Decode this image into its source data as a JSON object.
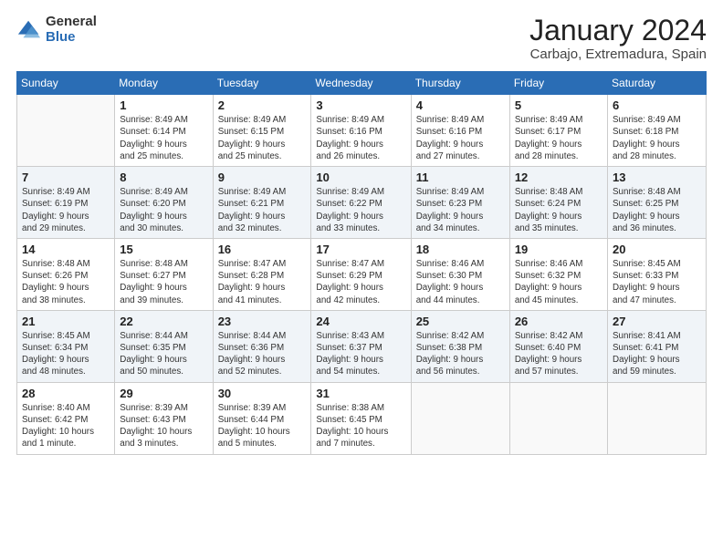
{
  "logo": {
    "general": "General",
    "blue": "Blue"
  },
  "title": "January 2024",
  "subtitle": "Carbajo, Extremadura, Spain",
  "days_header": [
    "Sunday",
    "Monday",
    "Tuesday",
    "Wednesday",
    "Thursday",
    "Friday",
    "Saturday"
  ],
  "weeks": [
    [
      {
        "num": "",
        "info": ""
      },
      {
        "num": "1",
        "info": "Sunrise: 8:49 AM\nSunset: 6:14 PM\nDaylight: 9 hours\nand 25 minutes."
      },
      {
        "num": "2",
        "info": "Sunrise: 8:49 AM\nSunset: 6:15 PM\nDaylight: 9 hours\nand 25 minutes."
      },
      {
        "num": "3",
        "info": "Sunrise: 8:49 AM\nSunset: 6:16 PM\nDaylight: 9 hours\nand 26 minutes."
      },
      {
        "num": "4",
        "info": "Sunrise: 8:49 AM\nSunset: 6:16 PM\nDaylight: 9 hours\nand 27 minutes."
      },
      {
        "num": "5",
        "info": "Sunrise: 8:49 AM\nSunset: 6:17 PM\nDaylight: 9 hours\nand 28 minutes."
      },
      {
        "num": "6",
        "info": "Sunrise: 8:49 AM\nSunset: 6:18 PM\nDaylight: 9 hours\nand 28 minutes."
      }
    ],
    [
      {
        "num": "7",
        "info": "Sunrise: 8:49 AM\nSunset: 6:19 PM\nDaylight: 9 hours\nand 29 minutes."
      },
      {
        "num": "8",
        "info": "Sunrise: 8:49 AM\nSunset: 6:20 PM\nDaylight: 9 hours\nand 30 minutes."
      },
      {
        "num": "9",
        "info": "Sunrise: 8:49 AM\nSunset: 6:21 PM\nDaylight: 9 hours\nand 32 minutes."
      },
      {
        "num": "10",
        "info": "Sunrise: 8:49 AM\nSunset: 6:22 PM\nDaylight: 9 hours\nand 33 minutes."
      },
      {
        "num": "11",
        "info": "Sunrise: 8:49 AM\nSunset: 6:23 PM\nDaylight: 9 hours\nand 34 minutes."
      },
      {
        "num": "12",
        "info": "Sunrise: 8:48 AM\nSunset: 6:24 PM\nDaylight: 9 hours\nand 35 minutes."
      },
      {
        "num": "13",
        "info": "Sunrise: 8:48 AM\nSunset: 6:25 PM\nDaylight: 9 hours\nand 36 minutes."
      }
    ],
    [
      {
        "num": "14",
        "info": "Sunrise: 8:48 AM\nSunset: 6:26 PM\nDaylight: 9 hours\nand 38 minutes."
      },
      {
        "num": "15",
        "info": "Sunrise: 8:48 AM\nSunset: 6:27 PM\nDaylight: 9 hours\nand 39 minutes."
      },
      {
        "num": "16",
        "info": "Sunrise: 8:47 AM\nSunset: 6:28 PM\nDaylight: 9 hours\nand 41 minutes."
      },
      {
        "num": "17",
        "info": "Sunrise: 8:47 AM\nSunset: 6:29 PM\nDaylight: 9 hours\nand 42 minutes."
      },
      {
        "num": "18",
        "info": "Sunrise: 8:46 AM\nSunset: 6:30 PM\nDaylight: 9 hours\nand 44 minutes."
      },
      {
        "num": "19",
        "info": "Sunrise: 8:46 AM\nSunset: 6:32 PM\nDaylight: 9 hours\nand 45 minutes."
      },
      {
        "num": "20",
        "info": "Sunrise: 8:45 AM\nSunset: 6:33 PM\nDaylight: 9 hours\nand 47 minutes."
      }
    ],
    [
      {
        "num": "21",
        "info": "Sunrise: 8:45 AM\nSunset: 6:34 PM\nDaylight: 9 hours\nand 48 minutes."
      },
      {
        "num": "22",
        "info": "Sunrise: 8:44 AM\nSunset: 6:35 PM\nDaylight: 9 hours\nand 50 minutes."
      },
      {
        "num": "23",
        "info": "Sunrise: 8:44 AM\nSunset: 6:36 PM\nDaylight: 9 hours\nand 52 minutes."
      },
      {
        "num": "24",
        "info": "Sunrise: 8:43 AM\nSunset: 6:37 PM\nDaylight: 9 hours\nand 54 minutes."
      },
      {
        "num": "25",
        "info": "Sunrise: 8:42 AM\nSunset: 6:38 PM\nDaylight: 9 hours\nand 56 minutes."
      },
      {
        "num": "26",
        "info": "Sunrise: 8:42 AM\nSunset: 6:40 PM\nDaylight: 9 hours\nand 57 minutes."
      },
      {
        "num": "27",
        "info": "Sunrise: 8:41 AM\nSunset: 6:41 PM\nDaylight: 9 hours\nand 59 minutes."
      }
    ],
    [
      {
        "num": "28",
        "info": "Sunrise: 8:40 AM\nSunset: 6:42 PM\nDaylight: 10 hours\nand 1 minute."
      },
      {
        "num": "29",
        "info": "Sunrise: 8:39 AM\nSunset: 6:43 PM\nDaylight: 10 hours\nand 3 minutes."
      },
      {
        "num": "30",
        "info": "Sunrise: 8:39 AM\nSunset: 6:44 PM\nDaylight: 10 hours\nand 5 minutes."
      },
      {
        "num": "31",
        "info": "Sunrise: 8:38 AM\nSunset: 6:45 PM\nDaylight: 10 hours\nand 7 minutes."
      },
      {
        "num": "",
        "info": ""
      },
      {
        "num": "",
        "info": ""
      },
      {
        "num": "",
        "info": ""
      }
    ]
  ]
}
